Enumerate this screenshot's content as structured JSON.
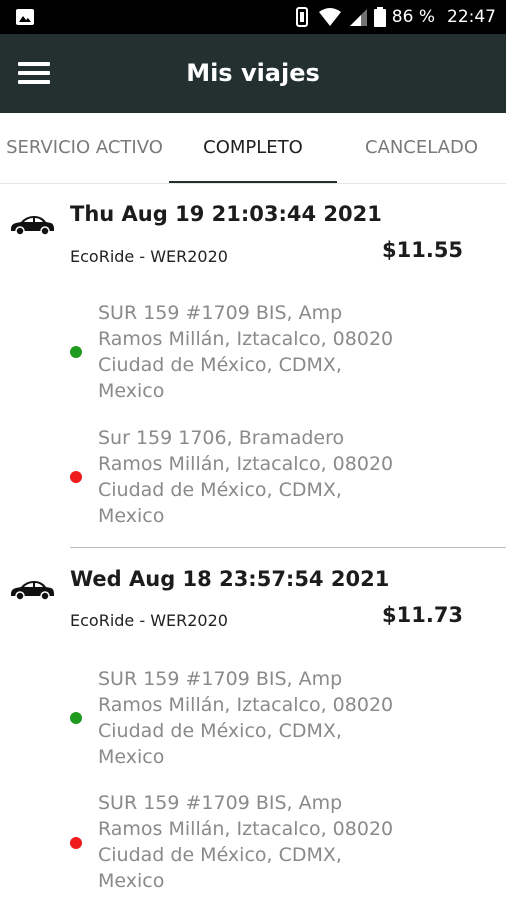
{
  "status_bar": {
    "battery": "86 %",
    "time": "22:47"
  },
  "app_bar": {
    "title": "Mis viajes"
  },
  "tabs": [
    {
      "label": "SERVICIO ACTIVO",
      "active": false
    },
    {
      "label": "COMPLETO",
      "active": true
    },
    {
      "label": "CANCELADO",
      "active": false
    }
  ],
  "trips": [
    {
      "date": "Thu Aug 19 21:03:44 2021",
      "vehicle": "EcoRide - WER2020",
      "price": "$11.55",
      "origin": "SUR 159 #1709 BIS, Amp Ramos Millán, Iztacalco, 08020 Ciudad de México, CDMX, Mexico",
      "destination": "Sur 159 1706, Bramadero Ramos Millán, Iztacalco, 08020 Ciudad de México, CDMX, Mexico"
    },
    {
      "date": "Wed Aug 18 23:57:54 2021",
      "vehicle": "EcoRide - WER2020",
      "price": "$11.73",
      "origin": "SUR 159 #1709 BIS, Amp Ramos Millán, Iztacalco, 08020 Ciudad de México, CDMX, Mexico",
      "destination": "SUR 159 #1709 BIS, Amp Ramos Millán, Iztacalco, 08020 Ciudad de México, CDMX, Mexico"
    }
  ],
  "colors": {
    "app_bar": "#23302f",
    "origin_dot": "#1e9a1e",
    "destination_dot": "#ef1c1c"
  }
}
